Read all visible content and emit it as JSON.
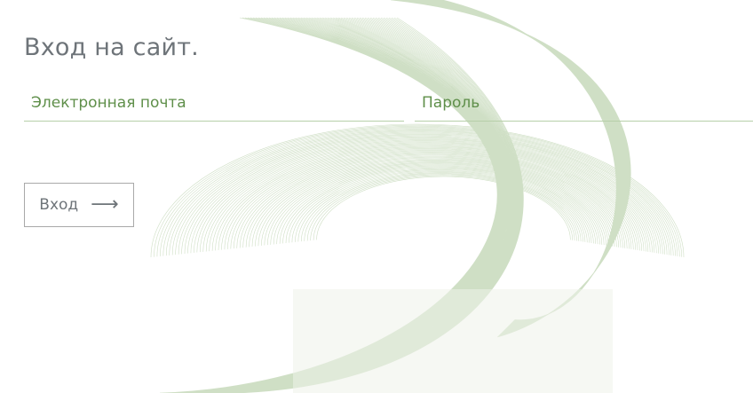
{
  "page": {
    "title": "Вход на сайт."
  },
  "form": {
    "email_placeholder": "Электронная почта",
    "password_placeholder": "Пароль",
    "submit_label": "Вход",
    "submit_icon": "arrow-right-icon"
  },
  "colors": {
    "accent_green": "#5f8f4a",
    "underline_green": "#b7cfa9",
    "text_gray": "#6e7479",
    "button_border": "#a9a9a9"
  }
}
